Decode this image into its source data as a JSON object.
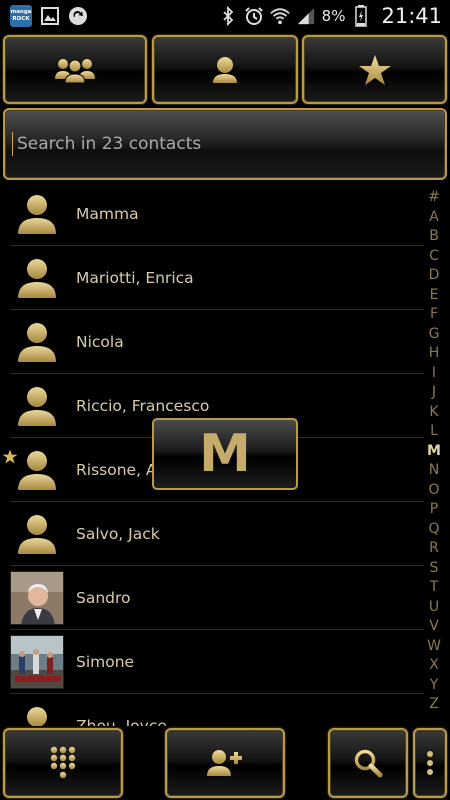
{
  "status_bar": {
    "app_badge_line1": "manga",
    "app_badge_line2": "ROCK",
    "battery_percent": "8%",
    "time": "21:41"
  },
  "top_tabs": [
    {
      "icon": "group-icon"
    },
    {
      "icon": "person-icon"
    },
    {
      "icon": "star-icon"
    }
  ],
  "search": {
    "placeholder": "Search in 23 contacts"
  },
  "contacts": [
    {
      "name": "Mamma",
      "avatar": "default",
      "favorite": false
    },
    {
      "name": "Mariotti, Enrica",
      "avatar": "default",
      "favorite": false
    },
    {
      "name": "Nicola",
      "avatar": "default",
      "favorite": false
    },
    {
      "name": "Riccio, Francesco",
      "avatar": "default",
      "favorite": false
    },
    {
      "name": "Rissone, A",
      "avatar": "default",
      "favorite": true
    },
    {
      "name": "Salvo, Jack",
      "avatar": "default",
      "favorite": false
    },
    {
      "name": "Sandro",
      "avatar": "photo",
      "favorite": false
    },
    {
      "name": "Simone",
      "avatar": "photo",
      "favorite": false
    },
    {
      "name": "Zhou, Joyce",
      "avatar": "default",
      "favorite": false
    }
  ],
  "index_letters": [
    "#",
    "A",
    "B",
    "C",
    "D",
    "E",
    "F",
    "G",
    "H",
    "I",
    "J",
    "K",
    "L",
    "M",
    "N",
    "O",
    "P",
    "Q",
    "R",
    "S",
    "T",
    "U",
    "V",
    "W",
    "X",
    "Y",
    "Z"
  ],
  "index_active": "M",
  "overlay_letter": "M",
  "bottom_bar": [
    {
      "icon": "dialpad-icon"
    },
    {
      "icon": "add-contact-icon"
    },
    {
      "icon": "search-icon"
    },
    {
      "icon": "menu-icon"
    }
  ],
  "colors": {
    "gold": "#b89a4a",
    "text": "#d6ccaa",
    "background": "#000000"
  }
}
